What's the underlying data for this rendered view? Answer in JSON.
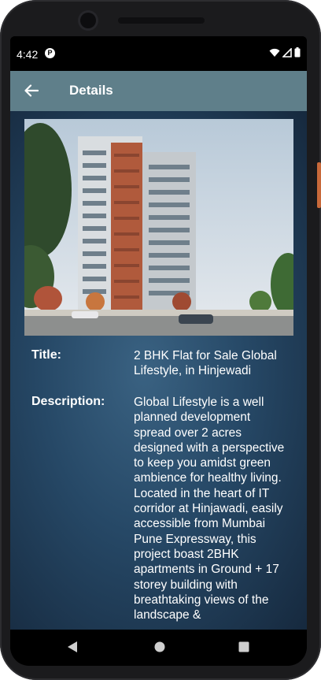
{
  "status_bar": {
    "time": "4:42"
  },
  "toolbar": {
    "title": "Details"
  },
  "details": {
    "title_label": "Title:",
    "title_value": "2 BHK Flat for Sale Global Lifestyle, in Hinjewadi",
    "description_label": "Description:",
    "description_value": "Global Lifestyle is a well planned development spread over 2 acres designed with a perspective to keep you amidst green ambience for healthy living. Located in the heart of IT corridor at Hinjawadi, easily accessible from Mumbai Pune Expressway, this project boast 2BHK apartments in Ground + 17 storey building with breathtaking views of the landscape &"
  },
  "colors": {
    "toolbar": "#5f7f8a",
    "background_center": "#3a6282",
    "background_edge": "#16293e"
  },
  "icons": {
    "back": "arrow-left-icon",
    "wifi": "wifi-icon",
    "signal": "signal-icon",
    "battery": "battery-icon",
    "nav_back": "triangle-back-icon",
    "nav_home": "circle-home-icon",
    "nav_recents": "square-recents-icon"
  }
}
